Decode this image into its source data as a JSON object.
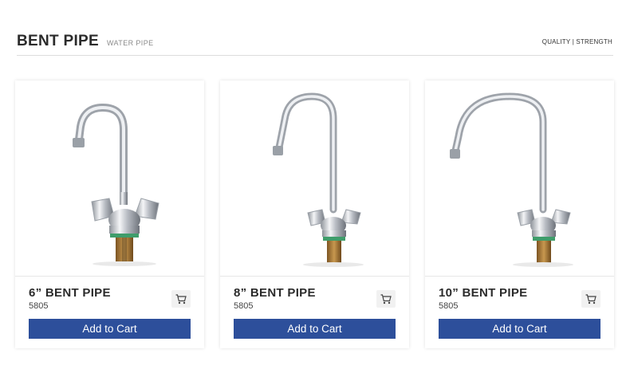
{
  "header": {
    "title": "BENT PIPE",
    "subtitle": "WATER PIPE",
    "tagline": "QUALITY | STRENGTH"
  },
  "products": [
    {
      "name": "6” BENT PIPE",
      "sku": "5805",
      "button_label": "Add to Cart",
      "cart_icon": "shopping-cart-icon",
      "image": "faucet-short-spout"
    },
    {
      "name": "8” BENT PIPE",
      "sku": "5805",
      "button_label": "Add to Cart",
      "cart_icon": "shopping-cart-icon",
      "image": "faucet-medium-spout"
    },
    {
      "name": "10” BENT PIPE",
      "sku": "5805",
      "button_label": "Add to Cart",
      "cart_icon": "shopping-cart-icon",
      "image": "faucet-long-spout"
    }
  ],
  "colors": {
    "button": "#2d4f9b",
    "chrome": "#c9ccd2",
    "brass": "#a7783a",
    "washer": "#3f9d6b"
  }
}
